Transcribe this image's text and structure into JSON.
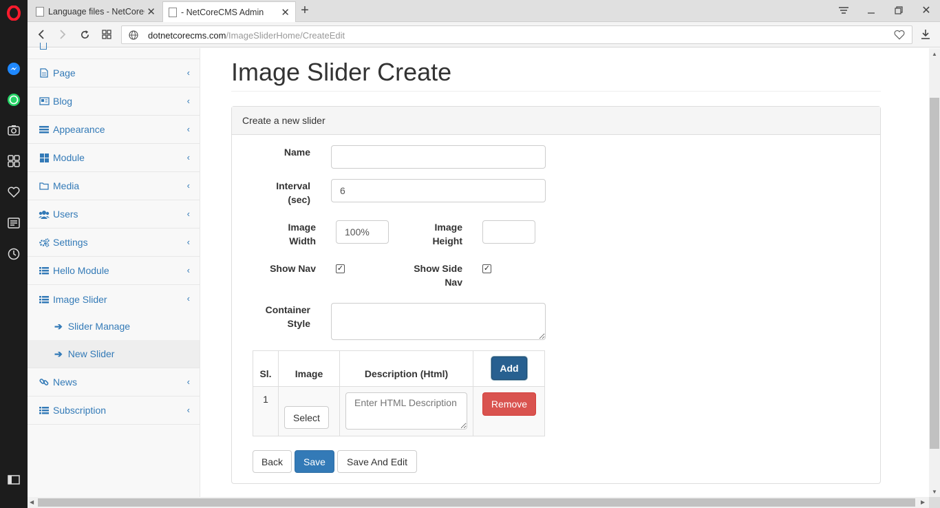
{
  "browser": {
    "tabs": [
      {
        "title": "Language files - NetCoreC"
      },
      {
        "title": "- NetCoreCMS Admin"
      }
    ],
    "url_host": "dotnetcorecms.com",
    "url_path": "/ImageSliderHome/CreateEdit"
  },
  "sidebar": {
    "items": [
      {
        "label": "Page",
        "icon": "file-icon"
      },
      {
        "label": "Blog",
        "icon": "newspaper-icon"
      },
      {
        "label": "Appearance",
        "icon": "list-icon"
      },
      {
        "label": "Module",
        "icon": "grid-icon"
      },
      {
        "label": "Media",
        "icon": "folder-icon"
      },
      {
        "label": "Users",
        "icon": "users-icon"
      },
      {
        "label": "Settings",
        "icon": "gears-icon"
      },
      {
        "label": "Hello Module",
        "icon": "list-icon"
      },
      {
        "label": "Image Slider",
        "icon": "list-icon"
      },
      {
        "label": "News",
        "icon": "link-icon"
      },
      {
        "label": "Subscription",
        "icon": "list-icon"
      }
    ],
    "subitems": [
      {
        "label": "Slider Manage"
      },
      {
        "label": "New Slider"
      }
    ]
  },
  "main": {
    "title": "Image Slider Create",
    "panel_heading": "Create a new slider",
    "form": {
      "name_label": "Name",
      "name_value": "",
      "interval_label": "Interval (sec)",
      "interval_value": "6",
      "image_width_label": "Image Width",
      "image_width_value": "100%",
      "image_height_label": "Image Height",
      "image_height_value": "",
      "show_nav_label": "Show Nav",
      "show_nav_checked": true,
      "show_side_nav_label": "Show Side Nav",
      "show_side_nav_checked": true,
      "container_style_label": "Container Style",
      "container_style_value": ""
    },
    "table": {
      "headers": [
        "Sl.",
        "Image",
        "Description (Html)"
      ],
      "add_label": "Add",
      "rows": [
        {
          "sl": "1",
          "select_label": "Select",
          "description_placeholder": "Enter HTML Description",
          "remove_label": "Remove"
        }
      ]
    },
    "buttons": {
      "back": "Back",
      "save": "Save",
      "save_and_edit": "Save And Edit"
    }
  },
  "colors": {
    "link": "#337ab7",
    "primary": "#337ab7",
    "danger": "#d9534f",
    "dock": "#1c1c1c"
  }
}
